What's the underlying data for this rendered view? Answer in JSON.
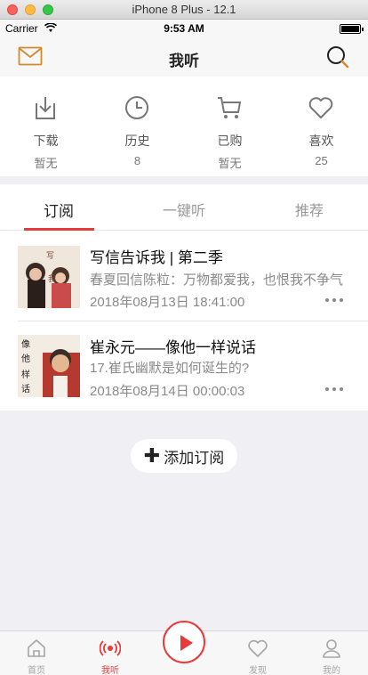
{
  "simulator": {
    "title": "iPhone 8 Plus - 12.1"
  },
  "status_bar": {
    "carrier": "Carrier",
    "time": "9:53 AM"
  },
  "navbar": {
    "title": "我听",
    "left_icon": "mail-icon",
    "right_icon": "search-icon"
  },
  "quick_access": [
    {
      "icon": "download-icon",
      "label": "下载",
      "value": "暂无"
    },
    {
      "icon": "history-icon",
      "label": "历史",
      "value": "8"
    },
    {
      "icon": "cart-icon",
      "label": "已购",
      "value": "暂无"
    },
    {
      "icon": "heart-icon",
      "label": "喜欢",
      "value": "25"
    }
  ],
  "tabs": [
    {
      "label": "订阅",
      "active": true
    },
    {
      "label": "一键听",
      "active": false
    },
    {
      "label": "推荐",
      "active": false
    }
  ],
  "subscriptions": [
    {
      "title": "写信告诉我 | 第二季",
      "subtitle": "春夏回信陈粒：万物都爱我，也恨我不争气",
      "date": "2018年08月13日 18:41:00"
    },
    {
      "title": "崔永元——像他一样说话",
      "subtitle": "17.崔氏幽默是如何诞生的?",
      "date": "2018年08月14日 00:00:03"
    }
  ],
  "add_button": {
    "label": "添加订阅"
  },
  "tabbar": [
    {
      "icon": "home-icon",
      "label": "首页",
      "active": false
    },
    {
      "icon": "radio-icon",
      "label": "我听",
      "active": true
    },
    {
      "icon": "heart-icon",
      "label": "发现",
      "active": false
    },
    {
      "icon": "profile-icon",
      "label": "我的",
      "active": false
    }
  ],
  "colors": {
    "accent": "#e83a3a",
    "background": "#efeff4",
    "text": "#222222",
    "muted": "#8a8a8a"
  }
}
